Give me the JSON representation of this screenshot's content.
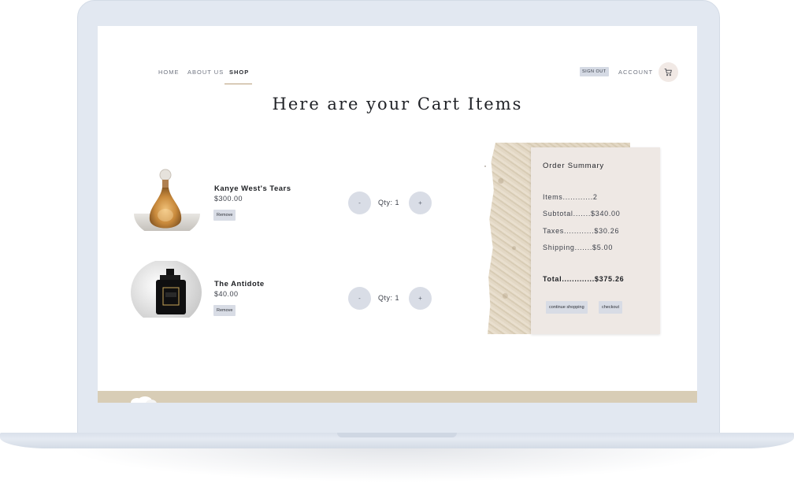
{
  "nav": {
    "links": [
      {
        "label": "HOME"
      },
      {
        "label": "ABOUT US"
      },
      {
        "label": "SHOP"
      }
    ],
    "signout_label": "SIGN OUT",
    "account_label": "ACCOUNT"
  },
  "page": {
    "title": "Here are your Cart Items"
  },
  "cart": {
    "items": [
      {
        "name": "Kanye West's Tears",
        "price": "$300.00",
        "remove_label": "Remove",
        "minus_label": "-",
        "qty_label": "Qty: 1",
        "plus_label": "+"
      },
      {
        "name": "The Antidote",
        "price": "$40.00",
        "remove_label": "Remove",
        "minus_label": "-",
        "qty_label": "Qty: 1",
        "plus_label": "+"
      }
    ]
  },
  "summary": {
    "title": "Order Summary",
    "items_line": "Items............2",
    "subtotal_line": "Subtotal.......$340.00",
    "taxes_line": "Taxes............$30.26",
    "shipping_line": "Shipping.......$5.00",
    "total_line": "Total.............$375.26",
    "continue_label": "continue shopping",
    "checkout_label": "checkout"
  },
  "colors": {
    "bezel": "#e2e8f1",
    "summary_bg": "#eee8e4",
    "button_bg": "#d8dce5",
    "footer": "#d8cdb6",
    "nav_underline": "#b89e7a"
  },
  "icons": {
    "cart": "shopping-cart-icon"
  }
}
